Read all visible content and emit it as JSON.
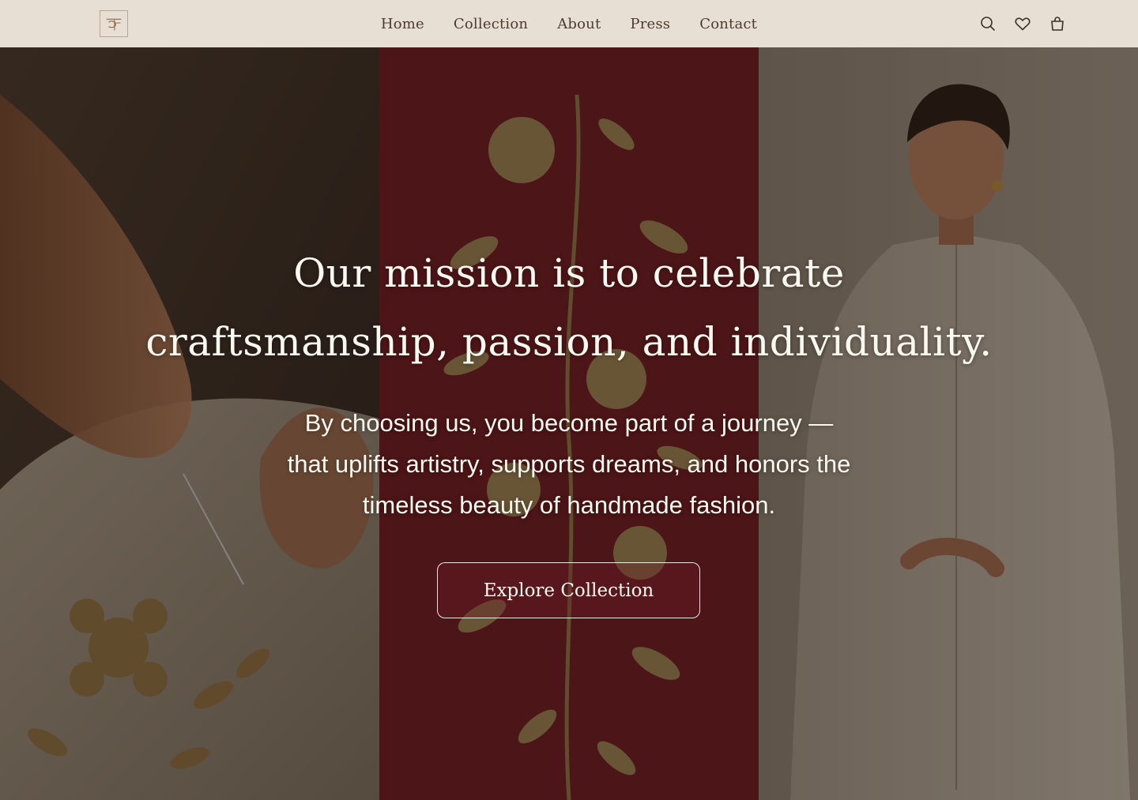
{
  "brand": {
    "logo_icon": "monogram-logo-icon"
  },
  "nav": {
    "links": [
      {
        "label": "Home"
      },
      {
        "label": "Collection"
      },
      {
        "label": "About"
      },
      {
        "label": "Press"
      },
      {
        "label": "Contact"
      }
    ],
    "icons": [
      "search-icon",
      "heart-icon",
      "shopping-bag-icon"
    ]
  },
  "hero": {
    "headline_line_1": "Our mission is to celebrate",
    "headline_line_2": "craftsmanship, passion, and individuality.",
    "subtext_line_1": "By choosing us, you become part of a journey —",
    "subtext_line_2": "that uplifts artistry, supports dreams, and honors the",
    "subtext_line_3": "timeless beauty of handmade fashion.",
    "cta_label": "Explore Collection",
    "panels": [
      "hand-embroidery-photo",
      "maroon-floral-embroidery-photo",
      "model-linen-kurta-photo"
    ]
  },
  "colors": {
    "nav_background": "#e7dfd4",
    "nav_text": "#4e3b2c",
    "maroon": "#6e1a20",
    "gold_thread": "#a78a52",
    "hero_text": "#fbf7f1"
  }
}
